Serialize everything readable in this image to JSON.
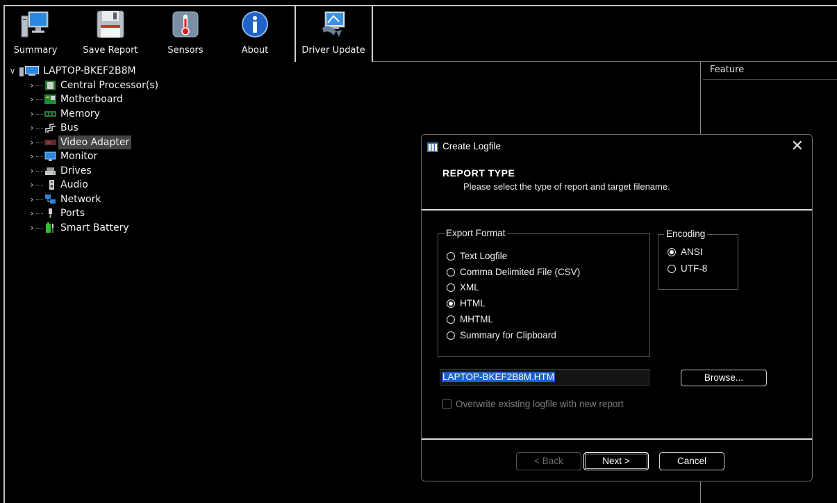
{
  "toolbar": {
    "buttons": [
      {
        "label": "Summary",
        "icon": "monitor-icon"
      },
      {
        "label": "Save Report",
        "icon": "floppy-disk-icon"
      },
      {
        "label": "Sensors",
        "icon": "thermometer-icon"
      },
      {
        "label": "About",
        "icon": "info-icon"
      },
      {
        "label": "Driver Update",
        "icon": "driver-update-icon"
      }
    ]
  },
  "tree": {
    "root": {
      "label": "LAPTOP-BKEF2B8M",
      "icon": "computer-icon",
      "expanded": true
    },
    "items": [
      {
        "label": "Central Processor(s)",
        "icon": "cpu-icon"
      },
      {
        "label": "Motherboard",
        "icon": "motherboard-icon"
      },
      {
        "label": "Memory",
        "icon": "memory-icon"
      },
      {
        "label": "Bus",
        "icon": "bus-icon"
      },
      {
        "label": "Video Adapter",
        "icon": "video-adapter-icon",
        "selected": true
      },
      {
        "label": "Monitor",
        "icon": "monitor-icon"
      },
      {
        "label": "Drives",
        "icon": "drives-icon"
      },
      {
        "label": "Audio",
        "icon": "audio-icon"
      },
      {
        "label": "Network",
        "icon": "network-icon"
      },
      {
        "label": "Ports",
        "icon": "ports-icon"
      },
      {
        "label": "Smart Battery",
        "icon": "battery-icon"
      }
    ]
  },
  "right_pane": {
    "column_header": "Feature"
  },
  "dialog": {
    "title": "Create Logfile",
    "close_glyph": "✕",
    "heading": "REPORT TYPE",
    "description": "Please select the type of report and target filename.",
    "export_format": {
      "legend": "Export Format",
      "options": [
        {
          "label": "Text Logfile",
          "checked": false
        },
        {
          "label": "Comma Delimited File (CSV)",
          "checked": false
        },
        {
          "label": "XML",
          "checked": false
        },
        {
          "label": "HTML",
          "checked": true
        },
        {
          "label": "MHTML",
          "checked": false
        },
        {
          "label": "Summary for Clipboard",
          "checked": false
        }
      ]
    },
    "encoding": {
      "legend": "Encoding",
      "options": [
        {
          "label": "ANSI",
          "checked": true
        },
        {
          "label": "UTF-8",
          "checked": false
        }
      ]
    },
    "filename": "LAPTOP-BKEF2B8M.HTM",
    "browse_label": "Browse...",
    "overwrite_label": "Overwrite existing logfile with new report",
    "overwrite_checked": false,
    "back_label": "< Back",
    "next_label": "Next >",
    "cancel_label": "Cancel"
  }
}
